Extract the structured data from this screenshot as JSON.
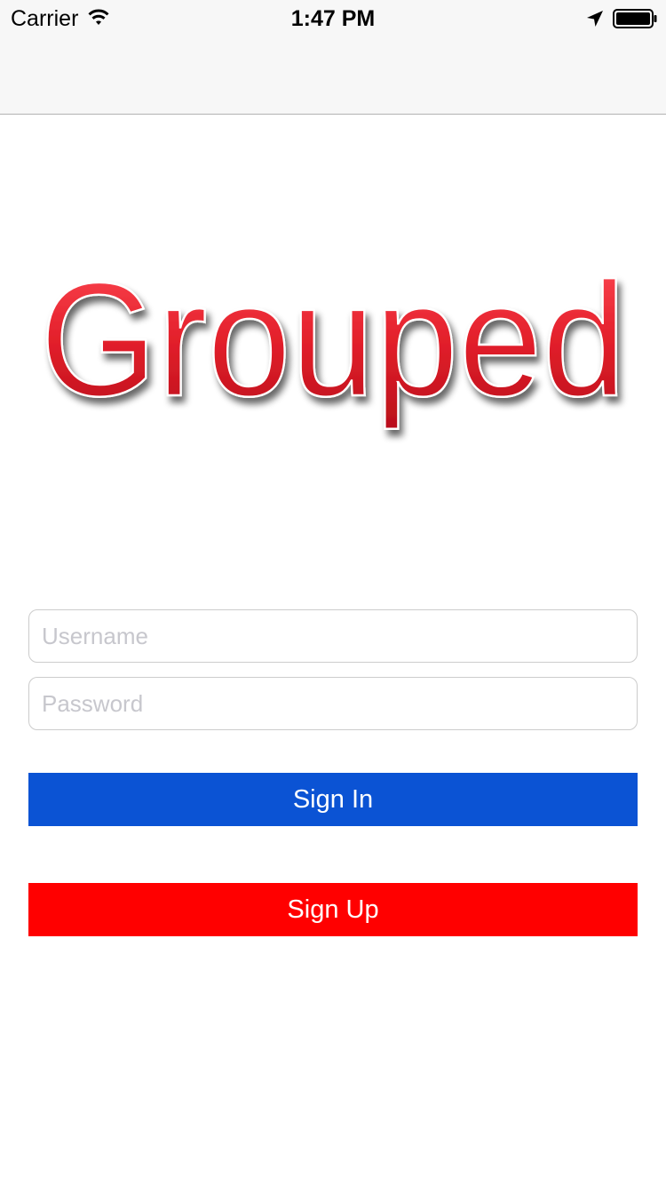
{
  "status_bar": {
    "carrier": "Carrier",
    "time": "1:47 PM",
    "icons": [
      "wifi-icon",
      "location-arrow-icon",
      "battery-icon"
    ]
  },
  "logo": {
    "text": "Grouped",
    "color": "#e0202a"
  },
  "form": {
    "username_placeholder": "Username",
    "password_placeholder": "Password",
    "username_value": "",
    "password_value": ""
  },
  "buttons": {
    "sign_in_label": "Sign In",
    "sign_up_label": "Sign Up",
    "sign_in_color": "#0b53d4",
    "sign_up_color": "#ff0000"
  }
}
